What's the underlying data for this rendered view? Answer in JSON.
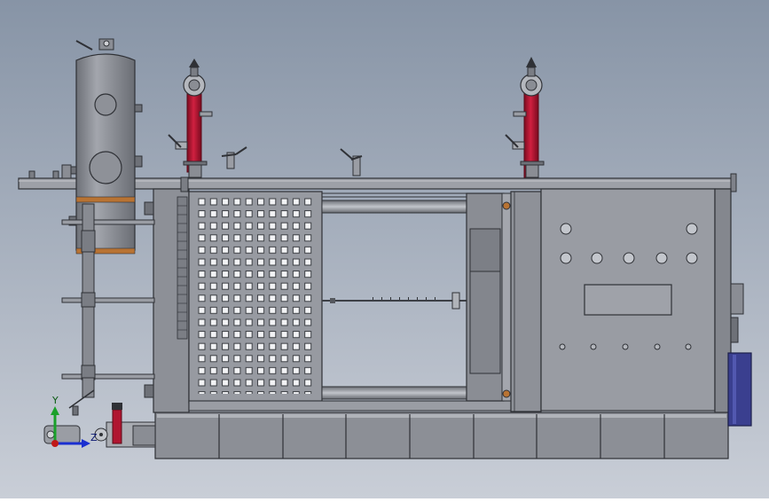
{
  "viewport": {
    "background_top": "#8794a6",
    "background_bottom": "#c9ced7"
  },
  "triad": {
    "y_label": "Y",
    "z_label": "Z",
    "y_color": "#1aa02a",
    "z_color": "#1a2fd0",
    "x_color": "#c01818"
  },
  "palette": {
    "steel": "#8a8d94",
    "steel_dark": "#5e6168",
    "steel_light": "#b4b7bd",
    "red_pipe": "#b01530",
    "copper": "#b87333",
    "navy": "#3a3f8f"
  }
}
